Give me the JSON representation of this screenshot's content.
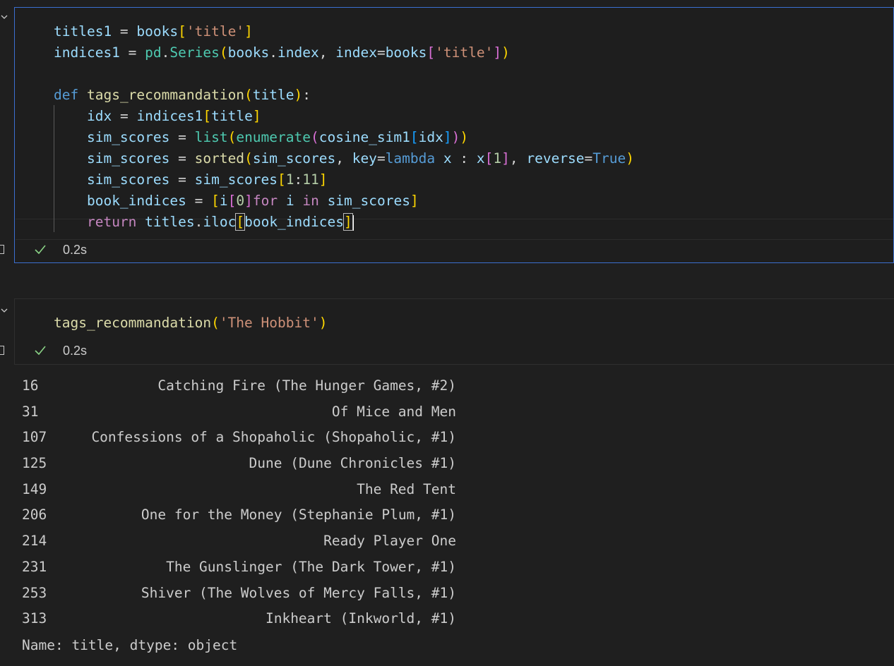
{
  "cell1": {
    "code_lines": [
      [
        {
          "t": "titles1",
          "c": "var"
        },
        {
          "t": " = ",
          "c": "op"
        },
        {
          "t": "books",
          "c": "var"
        },
        {
          "t": "[",
          "c": "br1"
        },
        {
          "t": "'title'",
          "c": "str"
        },
        {
          "t": "]",
          "c": "br1"
        }
      ],
      [
        {
          "t": "indices1",
          "c": "var"
        },
        {
          "t": " = ",
          "c": "op"
        },
        {
          "t": "pd",
          "c": "cls"
        },
        {
          "t": ".",
          "c": "op"
        },
        {
          "t": "Series",
          "c": "cls"
        },
        {
          "t": "(",
          "c": "br1"
        },
        {
          "t": "books",
          "c": "var"
        },
        {
          "t": ".",
          "c": "op"
        },
        {
          "t": "index",
          "c": "var"
        },
        {
          "t": ", ",
          "c": "op"
        },
        {
          "t": "index",
          "c": "var"
        },
        {
          "t": "=",
          "c": "op"
        },
        {
          "t": "books",
          "c": "var"
        },
        {
          "t": "[",
          "c": "br2"
        },
        {
          "t": "'title'",
          "c": "str"
        },
        {
          "t": "]",
          "c": "br2"
        },
        {
          "t": ")",
          "c": "br1"
        }
      ],
      [],
      [
        {
          "t": "def",
          "c": "kw"
        },
        {
          "t": " ",
          "c": "op"
        },
        {
          "t": "tags_recommandation",
          "c": "fn"
        },
        {
          "t": "(",
          "c": "br1"
        },
        {
          "t": "title",
          "c": "var"
        },
        {
          "t": ")",
          "c": "br1"
        },
        {
          "t": ":",
          "c": "op"
        }
      ],
      [
        {
          "t": "    ",
          "c": "op"
        },
        {
          "t": "idx",
          "c": "var"
        },
        {
          "t": " = ",
          "c": "op"
        },
        {
          "t": "indices1",
          "c": "var"
        },
        {
          "t": "[",
          "c": "br1"
        },
        {
          "t": "title",
          "c": "var"
        },
        {
          "t": "]",
          "c": "br1"
        }
      ],
      [
        {
          "t": "    ",
          "c": "op"
        },
        {
          "t": "sim_scores",
          "c": "var"
        },
        {
          "t": " = ",
          "c": "op"
        },
        {
          "t": "list",
          "c": "cls"
        },
        {
          "t": "(",
          "c": "br1"
        },
        {
          "t": "enumerate",
          "c": "cls"
        },
        {
          "t": "(",
          "c": "br2"
        },
        {
          "t": "cosine_sim1",
          "c": "var"
        },
        {
          "t": "[",
          "c": "br3"
        },
        {
          "t": "idx",
          "c": "var"
        },
        {
          "t": "]",
          "c": "br3"
        },
        {
          "t": ")",
          "c": "br2"
        },
        {
          "t": ")",
          "c": "br1"
        }
      ],
      [
        {
          "t": "    ",
          "c": "op"
        },
        {
          "t": "sim_scores",
          "c": "var"
        },
        {
          "t": " = ",
          "c": "op"
        },
        {
          "t": "sorted",
          "c": "fn"
        },
        {
          "t": "(",
          "c": "br1"
        },
        {
          "t": "sim_scores",
          "c": "var"
        },
        {
          "t": ", ",
          "c": "op"
        },
        {
          "t": "key",
          "c": "var"
        },
        {
          "t": "=",
          "c": "op"
        },
        {
          "t": "lambda",
          "c": "kw"
        },
        {
          "t": " ",
          "c": "op"
        },
        {
          "t": "x",
          "c": "var"
        },
        {
          "t": " : ",
          "c": "op"
        },
        {
          "t": "x",
          "c": "var"
        },
        {
          "t": "[",
          "c": "br2"
        },
        {
          "t": "1",
          "c": "num"
        },
        {
          "t": "]",
          "c": "br2"
        },
        {
          "t": ", ",
          "c": "op"
        },
        {
          "t": "reverse",
          "c": "var"
        },
        {
          "t": "=",
          "c": "op"
        },
        {
          "t": "True",
          "c": "kw"
        },
        {
          "t": ")",
          "c": "br1"
        }
      ],
      [
        {
          "t": "    ",
          "c": "op"
        },
        {
          "t": "sim_scores",
          "c": "var"
        },
        {
          "t": " = ",
          "c": "op"
        },
        {
          "t": "sim_scores",
          "c": "var"
        },
        {
          "t": "[",
          "c": "br1"
        },
        {
          "t": "1",
          "c": "num"
        },
        {
          "t": ":",
          "c": "op"
        },
        {
          "t": "11",
          "c": "num"
        },
        {
          "t": "]",
          "c": "br1"
        }
      ],
      [
        {
          "t": "    ",
          "c": "op"
        },
        {
          "t": "book_indices",
          "c": "var"
        },
        {
          "t": " = ",
          "c": "op"
        },
        {
          "t": "[",
          "c": "br1"
        },
        {
          "t": "i",
          "c": "var"
        },
        {
          "t": "[",
          "c": "br2"
        },
        {
          "t": "0",
          "c": "num"
        },
        {
          "t": "]",
          "c": "br2"
        },
        {
          "t": "for",
          "c": "ctl"
        },
        {
          "t": " ",
          "c": "op"
        },
        {
          "t": "i",
          "c": "var"
        },
        {
          "t": " ",
          "c": "op"
        },
        {
          "t": "in",
          "c": "ctl"
        },
        {
          "t": " ",
          "c": "op"
        },
        {
          "t": "sim_scores",
          "c": "var"
        },
        {
          "t": "]",
          "c": "br1"
        }
      ],
      [
        {
          "t": "    ",
          "c": "op"
        },
        {
          "t": "return",
          "c": "ctl"
        },
        {
          "t": " ",
          "c": "op"
        },
        {
          "t": "titles",
          "c": "var"
        },
        {
          "t": ".",
          "c": "op"
        },
        {
          "t": "iloc",
          "c": "var"
        },
        {
          "t": "[",
          "c": "br1",
          "box": true
        },
        {
          "t": "book_indices",
          "c": "var"
        },
        {
          "t": "]",
          "c": "br1",
          "box": true,
          "caret": true
        }
      ]
    ],
    "status": {
      "time": "0.2s"
    }
  },
  "cell2": {
    "code_lines": [
      [
        {
          "t": "tags_recommandation",
          "c": "fn"
        },
        {
          "t": "(",
          "c": "br1"
        },
        {
          "t": "'The Hobbit'",
          "c": "str"
        },
        {
          "t": ")",
          "c": "br1"
        }
      ]
    ],
    "status": {
      "time": "0.2s"
    }
  },
  "output": {
    "rows": [
      {
        "index": "16",
        "value": "Catching Fire (The Hunger Games, #2)"
      },
      {
        "index": "31",
        "value": "Of Mice and Men"
      },
      {
        "index": "107",
        "value": "Confessions of a Shopaholic (Shopaholic, #1)"
      },
      {
        "index": "125",
        "value": "Dune (Dune Chronicles #1)"
      },
      {
        "index": "149",
        "value": "The Red Tent"
      },
      {
        "index": "206",
        "value": "One for the Money (Stephanie Plum, #1)"
      },
      {
        "index": "214",
        "value": "Ready Player One"
      },
      {
        "index": "231",
        "value": "The Gunslinger (The Dark Tower, #1)"
      },
      {
        "index": "253",
        "value": "Shiver (The Wolves of Mercy Falls, #1)"
      },
      {
        "index": "313",
        "value": "Inkheart (Inkworld, #1)"
      }
    ],
    "footer": "Name: title, dtype: object"
  },
  "colors": {
    "focus_border": "#3b6fd0",
    "success_check": "#89d185"
  },
  "icons": {
    "collapse": "chevron-down-icon",
    "status": "check-icon",
    "exec_marker": "bracket-icon"
  }
}
